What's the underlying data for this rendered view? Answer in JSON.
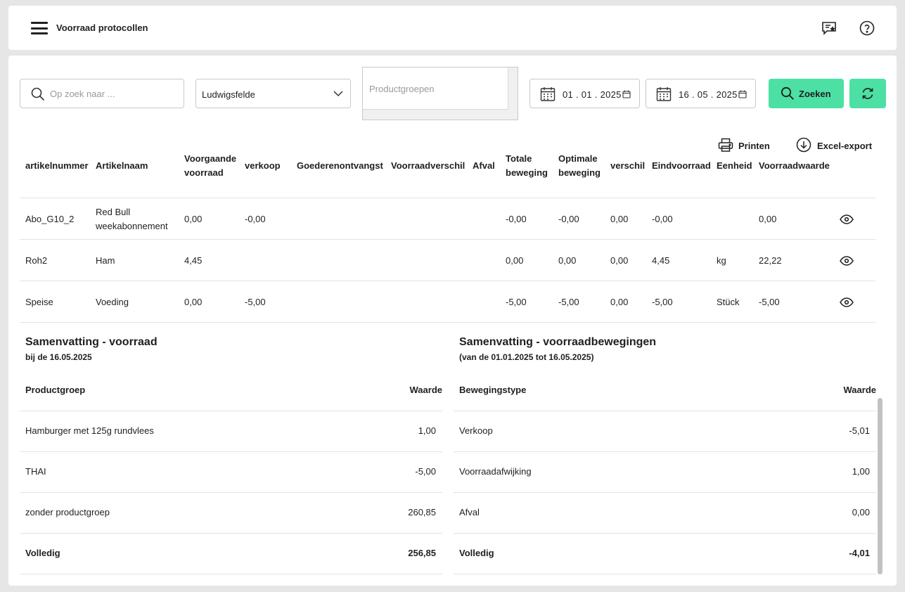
{
  "header": {
    "title": "Voorraad protocollen"
  },
  "filters": {
    "search_placeholder": "Op zoek naar ...",
    "location": "Ludwigsfelde",
    "productgroups_placeholder": "Productgroepen",
    "date_from": "01 . 01 . 2025",
    "date_to": "16 . 05 . 2025",
    "search_button": "Zoeken"
  },
  "actions": {
    "print": "Printen",
    "excel": "Excel-export"
  },
  "table": {
    "columns": [
      "artikelnummer",
      "Artikelnaam",
      "Voorgaande voorraad",
      "verkoop",
      "Goederenontvangst",
      "Voorraadverschil",
      "Afval",
      "Totale beweging",
      "Optimale beweging",
      "verschil",
      "Eindvoorraad",
      "Eenheid",
      "Voorraadwaarde"
    ],
    "rows": [
      [
        "Abo_G10_2",
        "Red Bull weekabonnement",
        "0,00",
        "-0,00",
        "",
        "",
        "",
        "-0,00",
        "-0,00",
        "0,00",
        "-0,00",
        "",
        "0,00"
      ],
      [
        "Roh2",
        "Ham",
        "4,45",
        "",
        "",
        "",
        "",
        "0,00",
        "0,00",
        "0,00",
        "4,45",
        "kg",
        "22,22"
      ],
      [
        "Speise",
        "Voeding",
        "0,00",
        "-5,00",
        "",
        "",
        "",
        "-5,00",
        "-5,00",
        "0,00",
        "-5,00",
        "Stück",
        "-5,00"
      ]
    ]
  },
  "summary_stock": {
    "title": "Samenvatting - voorraad",
    "subtitle": "bij de 16.05.2025",
    "col_group": "Productgroep",
    "col_value": "Waarde",
    "rows": [
      [
        "Hamburger met 125g rundvlees",
        "1,00"
      ],
      [
        "THAI",
        "-5,00"
      ],
      [
        "zonder productgroep",
        "260,85"
      ]
    ],
    "total_label": "Volledig",
    "total_value": "256,85"
  },
  "summary_movements": {
    "title": "Samenvatting - voorraadbewegingen",
    "subtitle": "(van de 01.01.2025 tot 16.05.2025)",
    "col_type": "Bewegingstype",
    "col_value": "Waarde",
    "rows": [
      [
        "Verkoop",
        "-5,01"
      ],
      [
        "Voorraadafwijking",
        "1,00"
      ],
      [
        "Afval",
        "0,00"
      ]
    ],
    "total_label": "Volledig",
    "total_value": "-4,01"
  },
  "icons": {
    "menu": "hamburger-menu-icon",
    "feedback": "chat-star-icon",
    "help": "help-icon",
    "search": "search-icon",
    "dropdown": "chevron-down-icon",
    "calendar": "calendar-icon",
    "refresh": "refresh-icon",
    "print": "printer-icon",
    "download": "download-icon",
    "view": "eye-icon"
  },
  "colors": {
    "accent": "#4ce0a4",
    "background": "#e6e6e6"
  }
}
